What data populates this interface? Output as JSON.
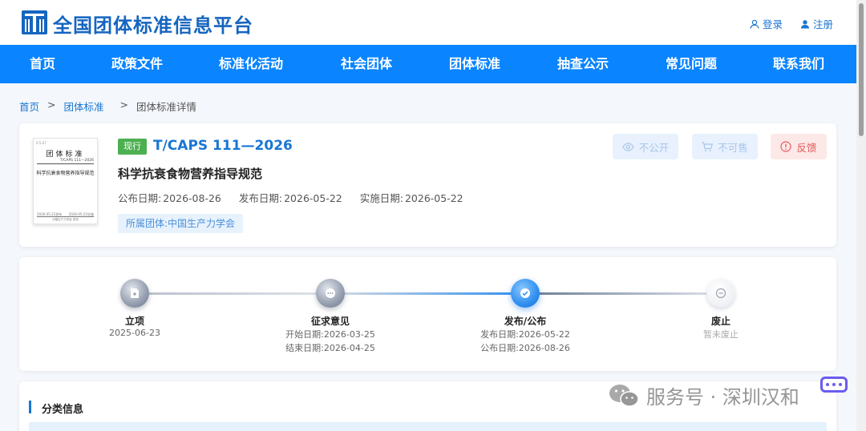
{
  "header": {
    "site_title": "全国团体标准信息平台",
    "login": "登录",
    "register": "注册"
  },
  "nav": {
    "items": [
      {
        "label": "首页"
      },
      {
        "label": "政策文件"
      },
      {
        "label": "标准化活动"
      },
      {
        "label": "社会团体"
      },
      {
        "label": "团体标准"
      },
      {
        "label": "抽查公示"
      },
      {
        "label": "常见问题"
      },
      {
        "label": "联系我们"
      }
    ]
  },
  "breadcrumb": {
    "home": "首页",
    "section": "团体标准",
    "current": "团体标准详情",
    "separator": ">"
  },
  "standard": {
    "status": "现行",
    "code": "T/CAPS 111—2026",
    "name": "科学抗衰食物营养指导规范",
    "dates": [
      {
        "label": "公布日期:",
        "value": "2026-08-26"
      },
      {
        "label": "发布日期:",
        "value": "2026-05-22"
      },
      {
        "label": "实施日期:",
        "value": "2026-05-22"
      }
    ],
    "org_label": "所属团体:",
    "org_name": "中国生产力学会",
    "cover": {
      "ics": "ICS 67",
      "title": "团体标准",
      "number": "T/CAPS 111—2026",
      "name": "科学抗衰食物营养指导规范",
      "publish": "2026-05-22发布",
      "implement": "2026-05-22实施",
      "org": "中国生产力学会 发布"
    }
  },
  "actions": {
    "not_public": "不公开",
    "not_for_sale": "不可售",
    "feedback": "反馈"
  },
  "timeline": {
    "steps": [
      {
        "label": "立项",
        "lines": [
          "2025-06-23"
        ],
        "state": "done"
      },
      {
        "label": "征求意见",
        "lines": [
          "开始日期:2026-03-25",
          "结束日期:2026-04-25"
        ],
        "state": "done"
      },
      {
        "label": "发布/公布",
        "lines": [
          "发布日期:2026-05-22",
          "公布日期:2026-08-26"
        ],
        "state": "current"
      },
      {
        "label": "废止",
        "lines": [
          "暂未废止"
        ],
        "state": "future"
      }
    ]
  },
  "classification": {
    "title": "分类信息"
  },
  "watermark": {
    "text": "服务号 · 深圳汉和"
  },
  "colors": {
    "primary": "#1976d2",
    "nav_bg": "#0a84ff",
    "status_green": "#4caf50",
    "danger": "#e35b5b"
  }
}
